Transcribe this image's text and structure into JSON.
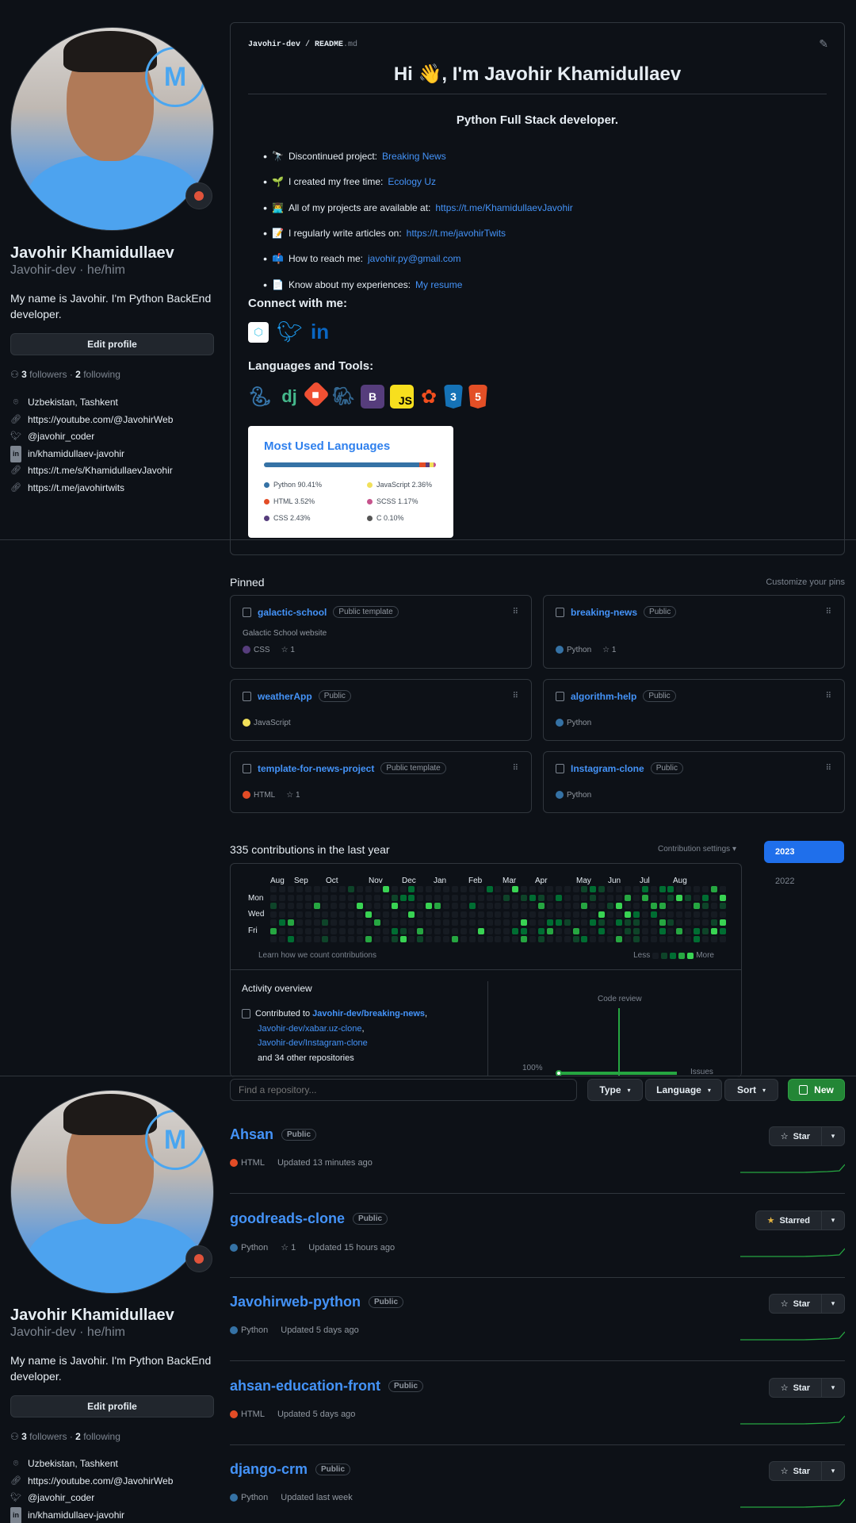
{
  "profile": {
    "name": "Javohir Khamidullaev",
    "login": "Javohir-dev · he/him",
    "bio": "My name is Javohir. I'm Python BackEnd developer.",
    "edit_label": "Edit profile",
    "followers_count": "3",
    "followers_label": "followers",
    "following_count": "2",
    "following_label": "following",
    "location": "Uzbekistan, Tashkent",
    "website": "https://youtube.com/@JavohirWeb",
    "twitter": "@javohir_coder",
    "linkedin": "in/khamidullaev-javohir",
    "link1": "https://t.me/s/KhamidullaevJavohir",
    "link2": "https://t.me/javohirtwits"
  },
  "readme": {
    "path_user": "Javohir-dev",
    "path_file": "README",
    "path_ext": ".md",
    "heading": "Hi 👋, I'm Javohir Khamidullaev",
    "subtitle": "Python Full Stack developer.",
    "items": [
      {
        "emoji": "🔭",
        "text": "Discontinued project:",
        "link": "Breaking News"
      },
      {
        "emoji": "🌱",
        "text": "I created my free time:",
        "link": "Ecology Uz"
      },
      {
        "emoji": "👨‍💻",
        "text": "All of my projects are available at:",
        "link": "https://t.me/KhamidullaevJavohir"
      },
      {
        "emoji": "📝",
        "text": "I regularly write articles on:",
        "link": "https://t.me/javohirTwits"
      },
      {
        "emoji": "📫",
        "text": "How to reach me:",
        "link": "javohir.py@gmail.com"
      },
      {
        "emoji": "📄",
        "text": "Know about my experiences:",
        "link": "My resume"
      }
    ],
    "connect_heading": "Connect with me:",
    "tools_heading": "Languages and Tools:",
    "tools": [
      "python",
      "django",
      "git",
      "postgresql",
      "bootstrap",
      "javascript",
      "figma",
      "css3",
      "html5"
    ]
  },
  "languages_card": {
    "title": "Most Used Languages",
    "items": [
      {
        "label": "Python 90.41%",
        "value": 90.41,
        "color": "#3572A5"
      },
      {
        "label": "JavaScript 2.36%",
        "value": 2.36,
        "color": "#f1e05a"
      },
      {
        "label": "HTML 3.52%",
        "value": 3.52,
        "color": "#e34c26"
      },
      {
        "label": "SCSS 1.17%",
        "value": 1.17,
        "color": "#c6538c"
      },
      {
        "label": "CSS 2.43%",
        "value": 2.43,
        "color": "#563d7c"
      },
      {
        "label": "C 0.10%",
        "value": 0.1,
        "color": "#555555"
      }
    ]
  },
  "pinned": {
    "heading": "Pinned",
    "customize": "Customize your pins",
    "items": [
      {
        "name": "galactic-school",
        "badge": "Public template",
        "desc": "Galactic School website",
        "lang": "CSS",
        "color": "#563d7c",
        "stars": "1"
      },
      {
        "name": "breaking-news",
        "badge": "Public",
        "desc": "",
        "lang": "Python",
        "color": "#3572A5",
        "stars": "1"
      },
      {
        "name": "weatherApp",
        "badge": "Public",
        "desc": "",
        "lang": "JavaScript",
        "color": "#f1e05a",
        "stars": ""
      },
      {
        "name": "algorithm-help",
        "badge": "Public",
        "desc": "",
        "lang": "Python",
        "color": "#3572A5",
        "stars": ""
      },
      {
        "name": "template-for-news-project",
        "badge": "Public template",
        "desc": "",
        "lang": "HTML",
        "color": "#e34c26",
        "stars": "1"
      },
      {
        "name": "Instagram-clone",
        "badge": "Public",
        "desc": "",
        "lang": "Python",
        "color": "#3572A5",
        "stars": ""
      }
    ]
  },
  "contributions": {
    "heading": "335 contributions in the last year",
    "settings": "Contribution settings ▾",
    "months": [
      "Aug",
      "Sep",
      "Oct",
      "Nov",
      "Dec",
      "Jan",
      "Feb",
      "Mar",
      "Apr",
      "May",
      "Jun",
      "Jul",
      "Aug"
    ],
    "days": [
      "Mon",
      "Wed",
      "Fri"
    ],
    "learn": "Learn how we count contributions",
    "less": "Less",
    "more": "More",
    "years": [
      "2023",
      "2022"
    ],
    "activity_heading": "Activity overview",
    "contributed_to": "Contributed to",
    "repos": [
      "Javohir-dev/breaking-news",
      "Javohir-dev/xabar.uz-clone",
      "Javohir-dev/Instagram-clone"
    ],
    "others": "and 34 other repositories",
    "code_review": "Code review",
    "issues": "Issues",
    "percent": "100%"
  },
  "repo_toolbar": {
    "search_placeholder": "Find a repository...",
    "type": "Type",
    "language": "Language",
    "sort": "Sort",
    "new": "New"
  },
  "repos": [
    {
      "name": "Ahsan",
      "badge": "Public",
      "lang": "HTML",
      "color": "#e34c26",
      "stars": "",
      "updated": "Updated 13 minutes ago",
      "star_label": "Star"
    },
    {
      "name": "goodreads-clone",
      "badge": "Public",
      "lang": "Python",
      "color": "#3572A5",
      "stars": "1",
      "updated": "Updated 15 hours ago",
      "star_label": "Starred"
    },
    {
      "name": "Javohirweb-python",
      "badge": "Public",
      "lang": "Python",
      "color": "#3572A5",
      "stars": "",
      "updated": "Updated 5 days ago",
      "star_label": "Star"
    },
    {
      "name": "ahsan-education-front",
      "badge": "Public",
      "lang": "HTML",
      "color": "#e34c26",
      "stars": "",
      "updated": "Updated 5 days ago",
      "star_label": "Star"
    },
    {
      "name": "django-crm",
      "badge": "Public",
      "lang": "Python",
      "color": "#3572A5",
      "stars": "",
      "updated": "Updated last week",
      "star_label": "Star"
    }
  ],
  "colors": {
    "accent": "#4493f8",
    "green": "#238636",
    "bg": "#0d1117",
    "border": "#30363d"
  }
}
